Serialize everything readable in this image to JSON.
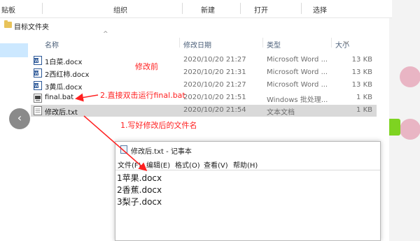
{
  "ribbon": {
    "groups": [
      "贴板",
      "组织",
      "新建",
      "打开",
      "选择"
    ]
  },
  "address": {
    "path": "目标文件夹"
  },
  "columns": {
    "name": "名称",
    "date": "修改日期",
    "type": "类型",
    "size": "大小"
  },
  "files": [
    {
      "name": "1白菜.docx",
      "date": "2020/10/20 21:27",
      "type": "Microsoft Word ...",
      "size": "13 KB",
      "icon": "word-doc-icon"
    },
    {
      "name": "2西红柿.docx",
      "date": "2020/10/20 21:31",
      "type": "Microsoft Word ...",
      "size": "13 KB",
      "icon": "word-doc-icon"
    },
    {
      "name": "3黄瓜.docx",
      "date": "2020/10/20 21:27",
      "type": "Microsoft Word ...",
      "size": "13 KB",
      "icon": "word-doc-icon"
    },
    {
      "name": "final.bat",
      "date": "2020/10/20 21:51",
      "type": "Windows 批处理...",
      "size": "1 KB",
      "icon": "batch-file-icon"
    },
    {
      "name": "修改后.txt",
      "date": "2020/10/20 21:54",
      "type": "文本文档",
      "size": "1 KB",
      "icon": "text-file-icon"
    }
  ],
  "annotations": {
    "before": "修改前",
    "step2": "2.直接双击运行final.bat",
    "step1": "1.写好修改后的文件名"
  },
  "notepad": {
    "title": "修改后.txt - 记事本",
    "menu": [
      "文件(F)",
      "编辑(E)",
      "格式(O)",
      "查看(V)",
      "帮助(H)"
    ],
    "lines": [
      "1苹果.docx",
      "2香蕉.docx",
      "3梨子.docx"
    ]
  },
  "colors": {
    "annotation": "#ff2020",
    "selected_row": "#d9d9d9",
    "nav_selected": "#cce8ff"
  }
}
